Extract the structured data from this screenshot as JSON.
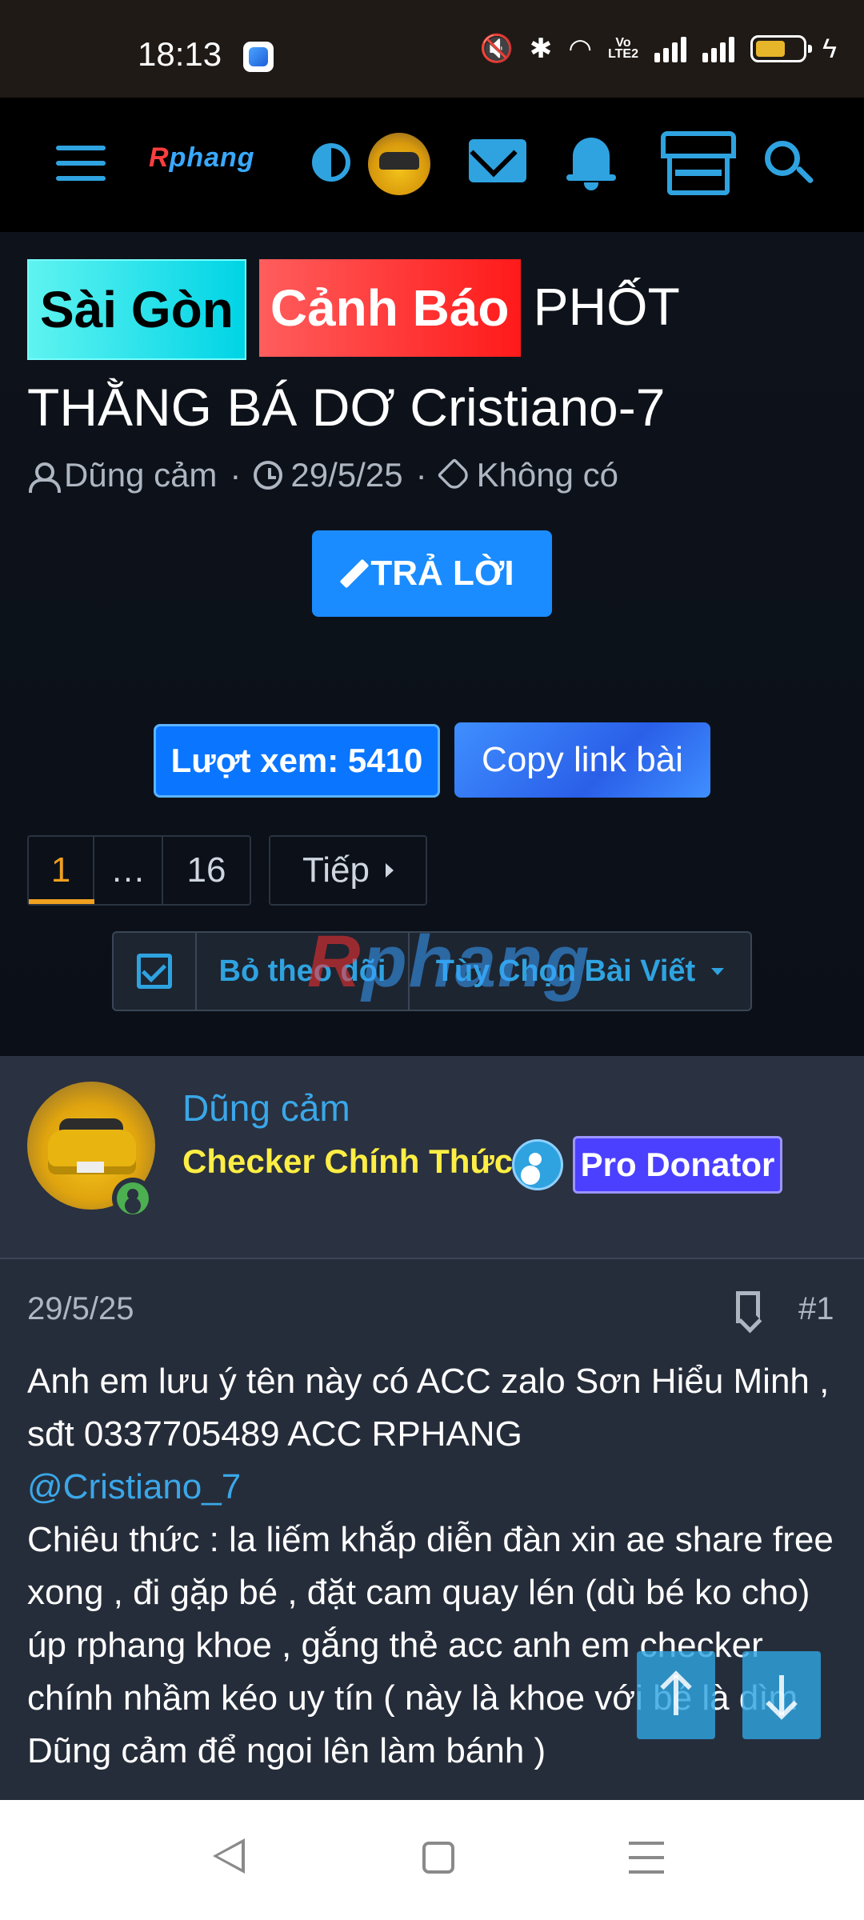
{
  "status_bar": {
    "time": "18:13"
  },
  "nav": {
    "logo_r": "R",
    "logo_rest": "phang"
  },
  "thread": {
    "label_1": "Sài Gòn",
    "label_2": "Cảnh Báo",
    "title": "PHỐT THẰNG BÁ DƠ Cristiano-7",
    "author": "Dũng cảm",
    "date": "29/5/25",
    "tags": "Không có",
    "meta_sep": "·",
    "reply_label": "TRẢ LỜI",
    "views_label": "Lượt xem: 5410",
    "copy_link_label": "Copy link bài"
  },
  "pagination": {
    "current": "1",
    "ellipsis": "…",
    "last": "16",
    "next_label": "Tiếp"
  },
  "actions": {
    "unfollow_label": "Bỏ theo dõi",
    "options_label": "Tùy Chọn Bài Viết"
  },
  "watermark": {
    "r": "R",
    "rest": "phang"
  },
  "author_block": {
    "name": "Dũng cảm",
    "title": "Checker Chính Thức",
    "badge": "Pro Donator"
  },
  "post": {
    "date": "29/5/25",
    "number": "#1",
    "line_1": "Anh em lưu ý tên này có ACC zalo Sơn Hiểu Minh , sđt 0337705489 ACC RPHANG",
    "mention": "@Cristiano_7",
    "line_2": "Chiêu thức : la liếm khắp diễn đàn xin ae share free xong , đi gặp bé , đặt cam quay lén (dù bé ko cho) úp rphang khoe , gắng thẻ acc anh em checker chính nhầm kéo uy tín ( này là khoe với bé là dìm Dũng cảm để ngoi lên làm bánh )"
  },
  "colors": {
    "accent": "#2fa3e0",
    "primary_button": "#1a8cff",
    "label_saigon": "#00d4e6",
    "label_canhbao": "#ff1a1a",
    "checker_title": "#ffee44",
    "pro_badge": "#4b40ff",
    "page_active": "#f0a020"
  }
}
